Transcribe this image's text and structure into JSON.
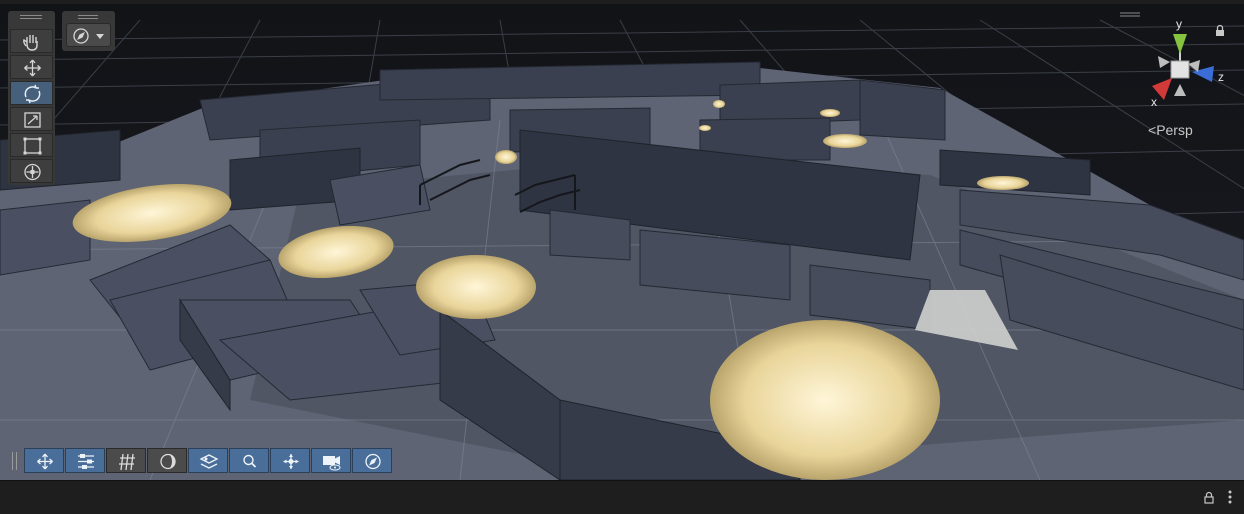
{
  "scene_view": {
    "camera_mode": "Persp",
    "axes": {
      "x": "x",
      "y": "y",
      "z": "z"
    }
  },
  "tools": [
    {
      "name": "hand-tool",
      "icon": "hand-icon",
      "active": false
    },
    {
      "name": "move-tool",
      "icon": "move-arrows-icon",
      "active": false
    },
    {
      "name": "rotate-tool",
      "icon": "rotate-icon",
      "active": true
    },
    {
      "name": "scale-tool",
      "icon": "scale-icon",
      "active": false
    },
    {
      "name": "rect-tool",
      "icon": "rect-icon",
      "active": false
    },
    {
      "name": "transform-tool",
      "icon": "transform-icon",
      "active": false
    }
  ],
  "draw_mode": {
    "icon": "compass-icon"
  },
  "overlay_toolbar": [
    {
      "name": "move-overlay-button",
      "icon": "move-icon",
      "state": "active"
    },
    {
      "name": "settings-overlay-button",
      "icon": "sliders-icon",
      "state": "active"
    },
    {
      "name": "grid-overlay-button",
      "icon": "grid-icon",
      "state": "inactive"
    },
    {
      "name": "shading-overlay-button",
      "icon": "moon-icon",
      "state": "inactive"
    },
    {
      "name": "layers-overlay-button",
      "icon": "layers-icon",
      "state": "active"
    },
    {
      "name": "search-overlay-button",
      "icon": "search-icon",
      "state": "active"
    },
    {
      "name": "pivot-overlay-button",
      "icon": "pivot-icon",
      "state": "active"
    },
    {
      "name": "camera-overlay-button",
      "icon": "camera-eye-icon",
      "state": "active"
    },
    {
      "name": "compass-overlay-button",
      "icon": "compass-icon",
      "state": "active"
    }
  ],
  "colors": {
    "active_button": "#4a6e9a",
    "axis_x": "#d23a3a",
    "axis_y": "#86c440",
    "axis_z": "#3a6ed6",
    "light_pool": "#fff2c2"
  }
}
